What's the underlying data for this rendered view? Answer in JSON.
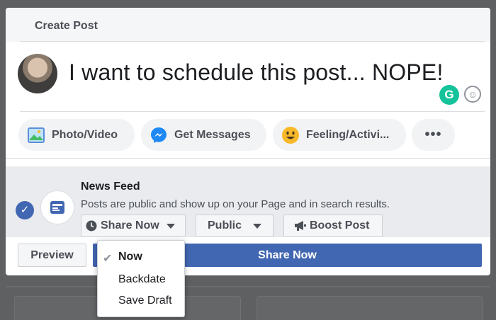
{
  "dialog": {
    "title": "Create Post",
    "composer_text": "I want to schedule this post... NOPE!",
    "grammarly_letter": "G"
  },
  "actions": {
    "photo_video": "Photo/Video",
    "get_messages": "Get Messages",
    "feeling": "Feeling/Activi...",
    "more": "•••"
  },
  "news_feed": {
    "title": "News Feed",
    "description": "Posts are public and show up on your Page and in search results.",
    "share_now_label": "Share Now",
    "audience_label": "Public",
    "boost_label": "Boost Post"
  },
  "footer": {
    "preview_label": "Preview",
    "share_label": "Share Now"
  },
  "dropdown": {
    "items": [
      "Now",
      "Backdate",
      "Save Draft"
    ],
    "selected": "Now"
  },
  "colors": {
    "primary": "#4267b2",
    "grammarly": "#15c39a",
    "overlay": "#5f6061"
  },
  "icons": {
    "photo": "photo-icon",
    "messenger": "messenger-icon",
    "feeling": "smiley-icon",
    "clock": "clock-icon",
    "megaphone": "megaphone-icon",
    "check": "checkmark-icon",
    "news_feed": "news-feed-icon"
  }
}
